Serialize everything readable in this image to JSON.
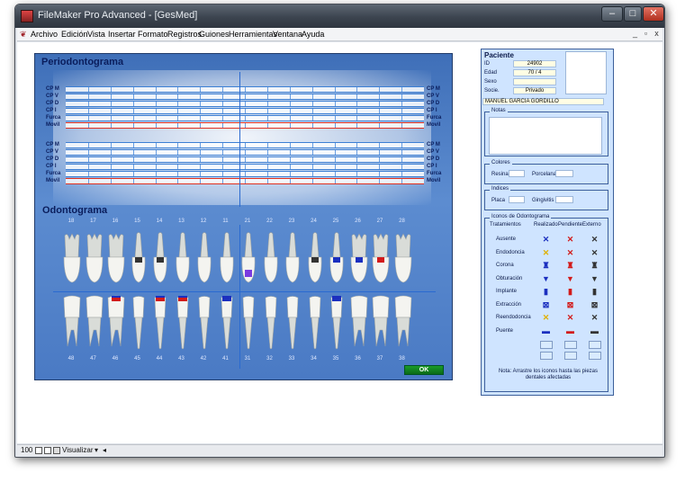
{
  "window": {
    "title": "FileMaker Pro Advanced - [GesMed]",
    "controls": [
      "–",
      "□",
      "✕"
    ],
    "mdi_controls": [
      "_",
      "▫",
      "x"
    ]
  },
  "menu": [
    "Archivo",
    "Edición",
    "Vista",
    "Insertar",
    "Formato",
    "Registros",
    "Guiones",
    "Herramientas",
    "Ventana",
    "Ayuda"
  ],
  "periodonto": {
    "title": "Periodontograma",
    "upper_rows": [
      "CP M",
      "CP V",
      "CP D",
      "CP I",
      "Furca",
      "Movil"
    ],
    "lower_rows": [
      "CP M",
      "CP V",
      "CP D",
      "CP I",
      "Furca",
      "Movil"
    ]
  },
  "odonto": {
    "title": "Odontograma",
    "upper_numbers": [
      "18",
      "17",
      "16",
      "15",
      "14",
      "13",
      "12",
      "11",
      "21",
      "22",
      "23",
      "24",
      "25",
      "26",
      "27",
      "28"
    ],
    "lower_numbers": [
      "48",
      "47",
      "46",
      "45",
      "44",
      "43",
      "42",
      "41",
      "31",
      "32",
      "33",
      "34",
      "35",
      "36",
      "37",
      "38"
    ],
    "ok_label": "OK"
  },
  "paciente": {
    "title": "Paciente",
    "fields": [
      {
        "label": "ID",
        "value": "24902"
      },
      {
        "label": "Edad",
        "value": "70 / 4"
      },
      {
        "label": "Sexo",
        "value": ""
      },
      {
        "label": "Socie.",
        "value": "Privado"
      }
    ],
    "name": "MANUEL GARCIA GORDILLO"
  },
  "notas": {
    "title": "Notas"
  },
  "colores": {
    "title": "Colores",
    "resina": "Resina",
    "porcelana": "Porcelana"
  },
  "indices": {
    "title": "Indices",
    "placa": "Placa",
    "gingivitis": "Gingivitis"
  },
  "iconos": {
    "title": "Iconos de Odontograma",
    "col_tratamientos": "Tratamientos",
    "col_realizado": "Realizado",
    "col_pendiente": "Pendiente",
    "col_externo": "Externo",
    "rows": [
      "Ausente",
      "Endodoncia",
      "Corona",
      "Obturación",
      "Implante",
      "Extracción",
      "Reendodoncia",
      "Puente"
    ],
    "note": "Nota: Arrastre los iconos hasta las piezas dentales afectadas"
  },
  "status": {
    "zoom": "100",
    "mode": "Visualizar"
  },
  "colors": {
    "realizado": "#1b2fbf",
    "pendiente": "#d21a1a",
    "externo": "#333333"
  }
}
